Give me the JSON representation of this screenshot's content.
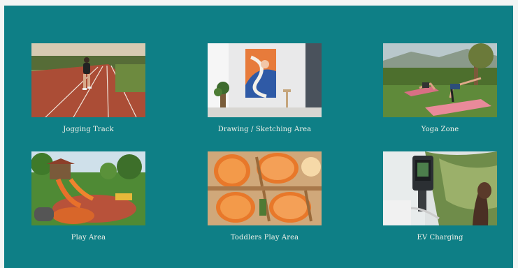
{
  "amenities": [
    {
      "label": "Jogging Track",
      "icon": "jogging-track-photo"
    },
    {
      "label": "Drawing / Sketching Area",
      "icon": "drawing-area-photo"
    },
    {
      "label": "Yoga Zone",
      "icon": "yoga-zone-photo"
    },
    {
      "label": "Play Area",
      "icon": "play-area-photo"
    },
    {
      "label": "Toddlers Play Area",
      "icon": "toddlers-play-area-photo"
    },
    {
      "label": "EV Charging",
      "icon": "ev-charging-photo"
    }
  ],
  "colors": {
    "panel": "#0e7f86",
    "caption": "#f2f2ea"
  }
}
